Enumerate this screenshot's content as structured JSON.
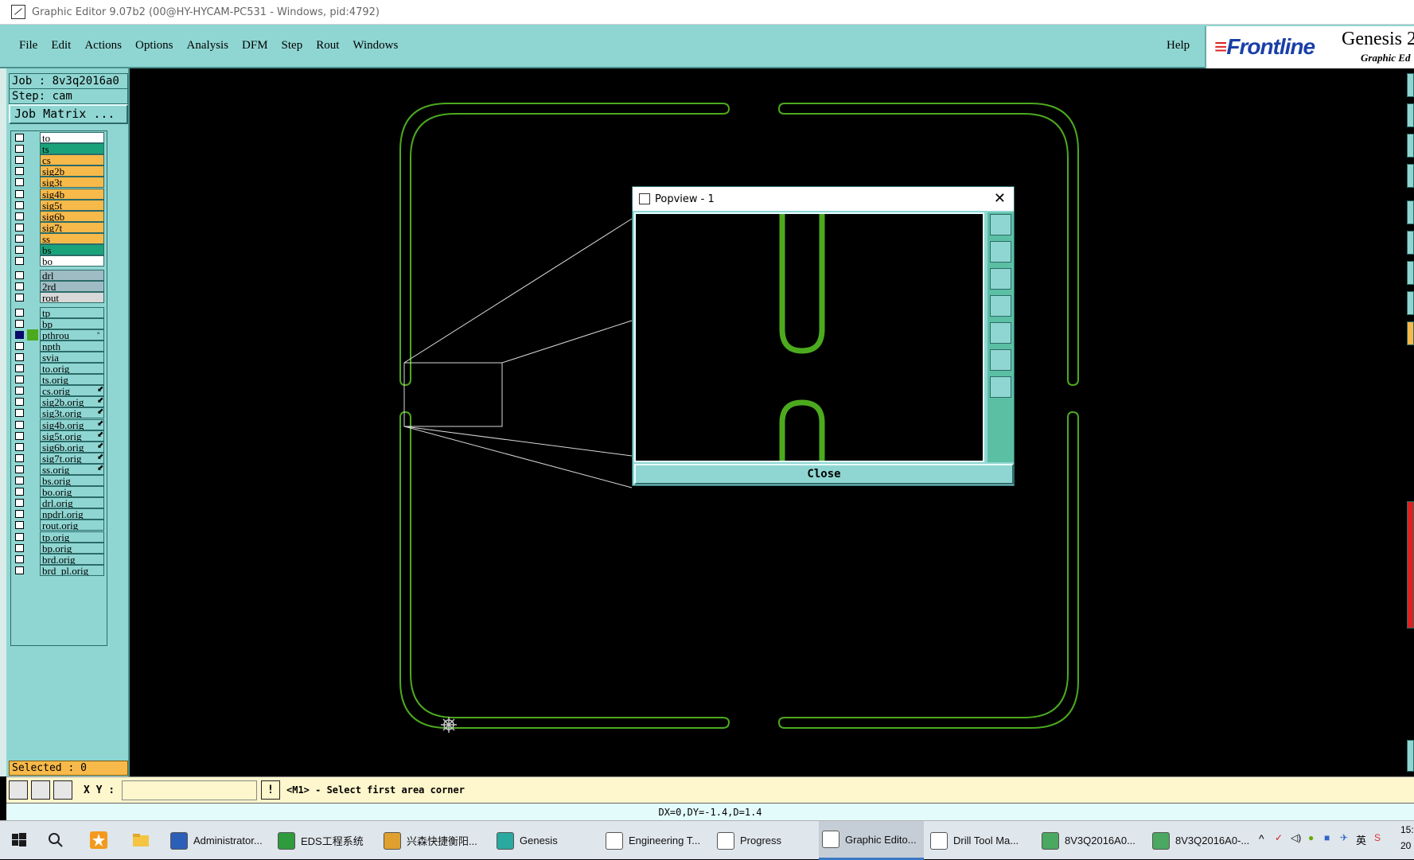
{
  "window": {
    "title": "Graphic Editor 9.07b2 (00@HY-HYCAM-PC531 - Windows, pid:4792)"
  },
  "menu": {
    "items": [
      "File",
      "Edit",
      "Actions",
      "Options",
      "Analysis",
      "DFM",
      "Step",
      "Rout",
      "Windows"
    ],
    "help": "Help"
  },
  "brand": {
    "logo": "Frontline",
    "product": "Genesis 2",
    "subtitle": "Graphic Ed"
  },
  "job": {
    "job_label": "Job : 8v3q2016a0",
    "step_label": "Step: cam",
    "matrix_button": "Job Matrix ..."
  },
  "layers": [
    {
      "name": "to",
      "color": "#ffffff",
      "group": 0
    },
    {
      "name": "ts",
      "color": "#1aa37a",
      "group": 0
    },
    {
      "name": "cs",
      "color": "#f7b94a",
      "group": 0
    },
    {
      "name": "sig2b",
      "color": "#f7b94a",
      "group": 0
    },
    {
      "name": "sig3t",
      "color": "#f7b94a",
      "group": 0
    },
    {
      "name": "sig4b",
      "color": "#f7b94a",
      "group": 0
    },
    {
      "name": "sig5t",
      "color": "#f7b94a",
      "group": 0
    },
    {
      "name": "sig6b",
      "color": "#f7b94a",
      "group": 0
    },
    {
      "name": "sig7t",
      "color": "#f7b94a",
      "group": 0
    },
    {
      "name": "ss",
      "color": "#f7b94a",
      "group": 0
    },
    {
      "name": "bs",
      "color": "#1aa37a",
      "group": 0
    },
    {
      "name": "bo",
      "color": "#ffffff",
      "group": 0
    },
    {
      "name": "drl",
      "color": "#9fbcc4",
      "group": 1
    },
    {
      "name": "2rd",
      "color": "#9fbcc4",
      "group": 1
    },
    {
      "name": "rout",
      "color": "#d8d8d8",
      "group": 1
    },
    {
      "name": "tp",
      "color": "#8fd6d2",
      "group": 2
    },
    {
      "name": "bp",
      "color": "#8fd6d2",
      "group": 2
    },
    {
      "name": "pthrou",
      "color": "#8fd6d2",
      "group": 2,
      "selected": true,
      "mark": "▫"
    },
    {
      "name": "npth",
      "color": "#8fd6d2",
      "group": 2
    },
    {
      "name": "svia",
      "color": "#8fd6d2",
      "group": 2
    },
    {
      "name": "to.orig",
      "color": "#8fd6d2",
      "group": 2
    },
    {
      "name": "ts.orig",
      "color": "#8fd6d2",
      "group": 2
    },
    {
      "name": "cs.orig",
      "color": "#8fd6d2",
      "group": 2,
      "mark": "⬋"
    },
    {
      "name": "sig2b.orig",
      "color": "#8fd6d2",
      "group": 2,
      "mark": "⬋"
    },
    {
      "name": "sig3t.orig",
      "color": "#8fd6d2",
      "group": 2,
      "mark": "⬋"
    },
    {
      "name": "sig4b.orig",
      "color": "#8fd6d2",
      "group": 2,
      "mark": "⬋"
    },
    {
      "name": "sig5t.orig",
      "color": "#8fd6d2",
      "group": 2,
      "mark": "⬋"
    },
    {
      "name": "sig6b.orig",
      "color": "#8fd6d2",
      "group": 2,
      "mark": "⬋"
    },
    {
      "name": "sig7t.orig",
      "color": "#8fd6d2",
      "group": 2,
      "mark": "⬋"
    },
    {
      "name": "ss.orig",
      "color": "#8fd6d2",
      "group": 2,
      "mark": "⬋"
    },
    {
      "name": "bs.orig",
      "color": "#8fd6d2",
      "group": 2
    },
    {
      "name": "bo.orig",
      "color": "#8fd6d2",
      "group": 2
    },
    {
      "name": "drl.orig",
      "color": "#8fd6d2",
      "group": 2
    },
    {
      "name": "npdrl.orig",
      "color": "#8fd6d2",
      "group": 2
    },
    {
      "name": "rout.orig",
      "color": "#8fd6d2",
      "group": 2
    },
    {
      "name": "tp.orig",
      "color": "#8fd6d2",
      "group": 2
    },
    {
      "name": "bp.orig",
      "color": "#8fd6d2",
      "group": 2
    },
    {
      "name": "brd.orig",
      "color": "#8fd6d2",
      "group": 2
    },
    {
      "name": "brd_pl.orig",
      "color": "#8fd6d2",
      "group": 2
    }
  ],
  "selected_label": "Selected : 0",
  "popview": {
    "title": "Popview - 1",
    "close_label": "Close",
    "close_x": "✕"
  },
  "bottom": {
    "xy_label": "X Y :",
    "xy_value": "",
    "warn": "!",
    "prompt": "<M1> - Select first area corner"
  },
  "status": "DX=0,DY=-1.4,D=1.4",
  "taskbar": {
    "items": [
      {
        "label": "Administrator...",
        "color": "#2c5fb8"
      },
      {
        "label": "EDS工程系统",
        "color": "#2e9b3c"
      },
      {
        "label": "兴森快捷衡阳...",
        "color": "#e0a030"
      },
      {
        "label": "Genesis",
        "color": "#2aa9a0"
      },
      {
        "label": "Engineering T...",
        "color": "#ffffff"
      },
      {
        "label": "Progress",
        "color": "#ffffff"
      },
      {
        "label": "Graphic Edito...",
        "color": "#ffffff",
        "active": true
      },
      {
        "label": "Drill Tool Ma...",
        "color": "#ffffff"
      },
      {
        "label": "8V3Q2016A0...",
        "color": "#4aa860"
      },
      {
        "label": "8V3Q2016A0-...",
        "color": "#4aa860"
      }
    ],
    "tray": {
      "ime": "英",
      "time": "15:",
      "date": "20"
    }
  },
  "colors": {
    "accent": "#8fd6d2",
    "board_outline": "#4caa1e",
    "prompt_bg": "#fef6cc"
  }
}
